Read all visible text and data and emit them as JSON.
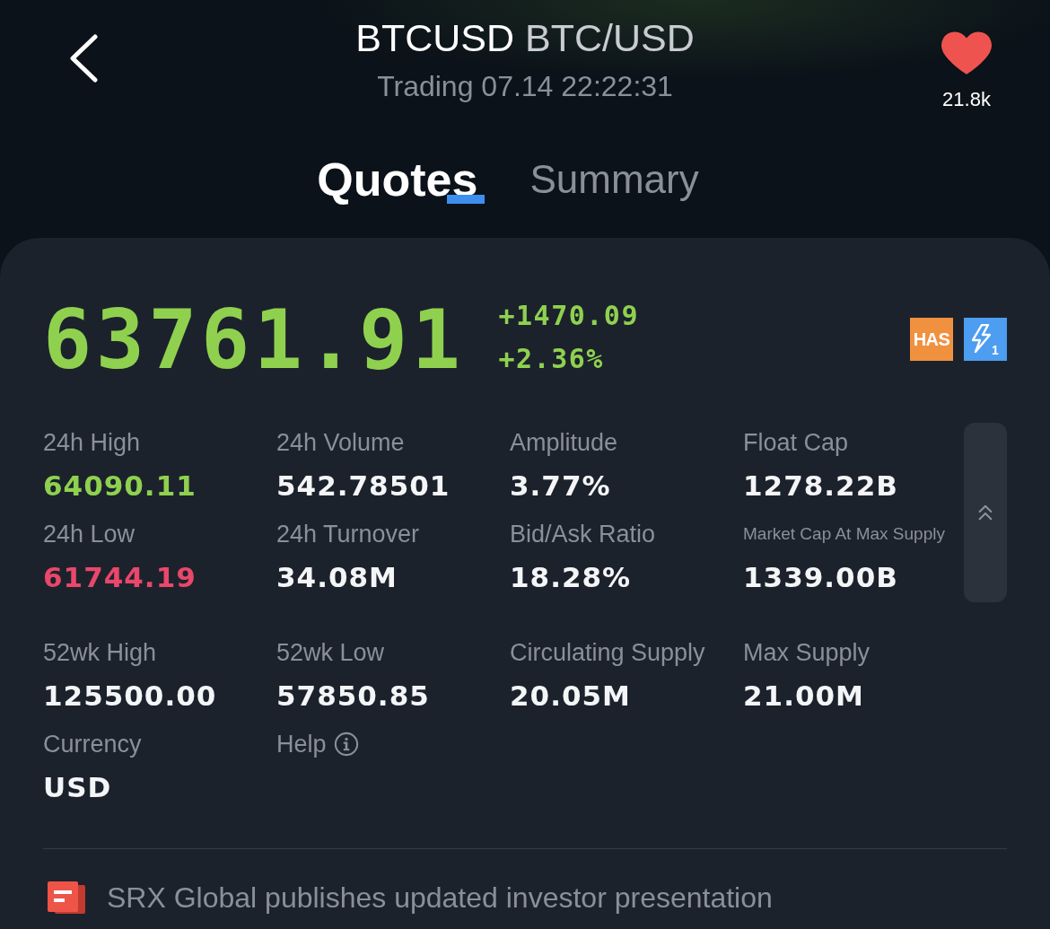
{
  "header": {
    "symbol": "BTCUSD",
    "name": "BTC/USD",
    "status": "Trading 07.14 22:22:31",
    "favorite": {
      "selected": true,
      "count": "21.8k"
    }
  },
  "tabs": [
    {
      "label": "Quotes",
      "selected": true
    },
    {
      "label": "Summary",
      "selected": false
    }
  ],
  "quote": {
    "price": "63761.91",
    "change": "+1470.09",
    "change_percent": "+2.36%",
    "color": "#8fd14f",
    "badges": [
      {
        "kind": "text",
        "label": "HAS"
      },
      {
        "kind": "lightning",
        "label": "1"
      }
    ]
  },
  "stats": {
    "expanded": true,
    "groups": [
      [
        {
          "kind": "stat",
          "label": "24h High",
          "value": "64090.11",
          "color": "#8fd14f"
        },
        {
          "kind": "stat",
          "label": "24h Volume",
          "value": "542.78501",
          "color": "#f4f5f7"
        },
        {
          "kind": "stat",
          "label": "Amplitude",
          "value": "3.77%",
          "color": "#f4f5f7"
        },
        {
          "kind": "stat",
          "label": "Float Cap",
          "value": "1278.22B",
          "color": "#f4f5f7"
        },
        {
          "kind": "stat",
          "label": "24h Low",
          "value": "61744.19",
          "color": "#e9476b"
        },
        {
          "kind": "stat",
          "label": "24h Turnover",
          "value": "34.08M",
          "color": "#f4f5f7"
        },
        {
          "kind": "stat",
          "label": "Bid/Ask Ratio",
          "value": "18.28%",
          "color": "#f4f5f7"
        },
        {
          "kind": "stat",
          "label": "Market Cap At Max Supply",
          "value": "1339.00B",
          "color": "#f4f5f7"
        }
      ],
      [
        {
          "kind": "stat",
          "label": "52wk High",
          "value": "125500.00",
          "color": "#f4f5f7"
        },
        {
          "kind": "stat",
          "label": "52wk Low",
          "value": "57850.85",
          "color": "#f4f5f7"
        },
        {
          "kind": "stat",
          "label": "Circulating Supply",
          "value": "20.05M",
          "color": "#f4f5f7"
        },
        {
          "kind": "stat",
          "label": "Max Supply",
          "value": "21.00M",
          "color": "#f4f5f7"
        },
        {
          "kind": "stat",
          "label": "Currency",
          "value": "USD",
          "color": "#f4f5f7"
        },
        {
          "kind": "help",
          "label": "Help"
        }
      ]
    ]
  },
  "news": [
    {
      "headline": "SRX Global publishes updated investor presentation"
    }
  ]
}
